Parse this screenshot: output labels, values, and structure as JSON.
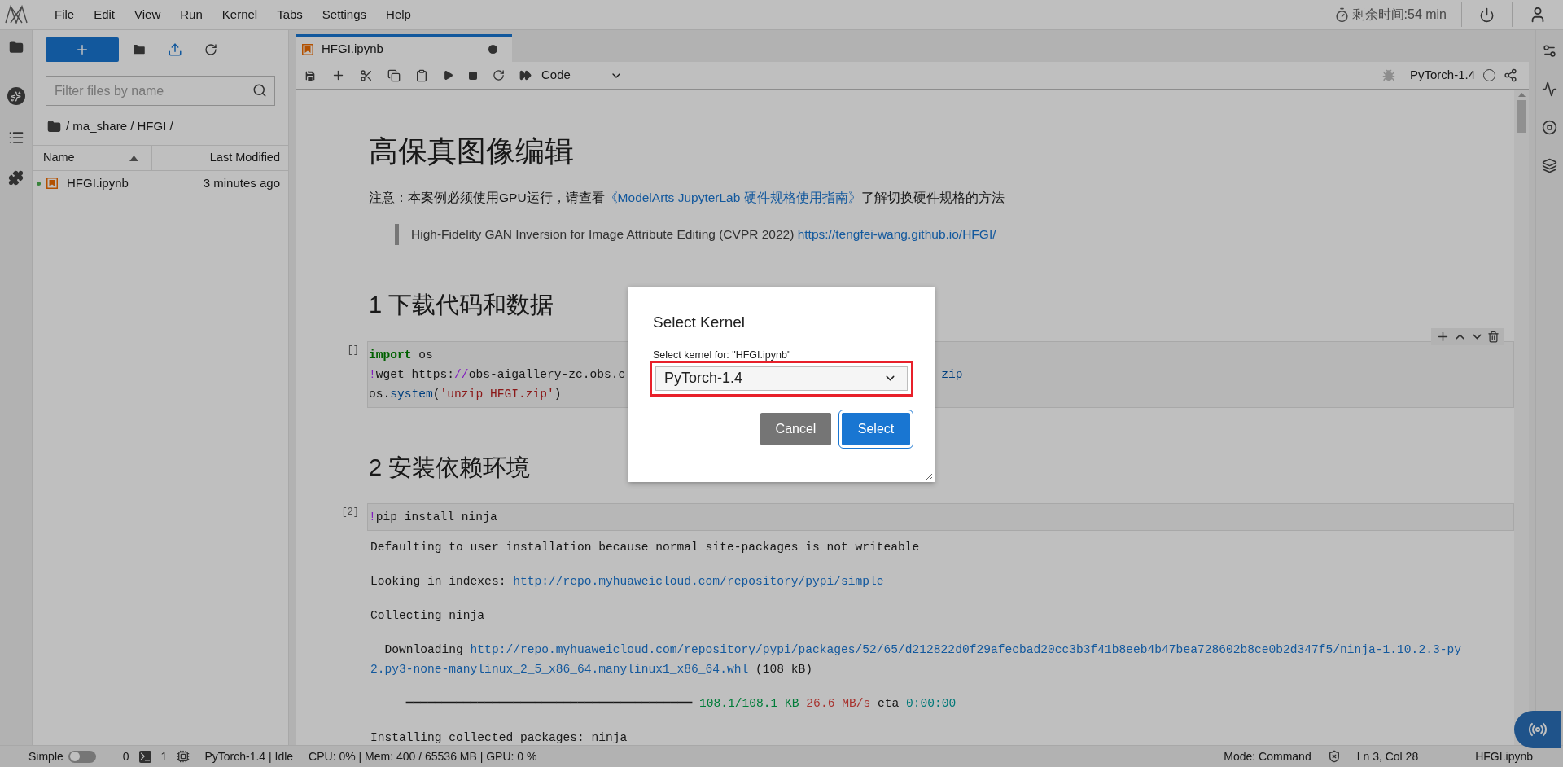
{
  "menu": [
    "File",
    "Edit",
    "View",
    "Run",
    "Kernel",
    "Tabs",
    "Settings",
    "Help"
  ],
  "timer": "剩余时间:54 min",
  "sidebar": {
    "filter_placeholder": "Filter files by name",
    "breadcrumb": "/ ma_share / HFGI /",
    "columns": [
      "Name",
      "Last Modified"
    ],
    "files": [
      {
        "name": "HFGI.ipynb",
        "modified": "3 minutes ago",
        "running": true
      }
    ]
  },
  "tab": {
    "title": "HFGI.ipynb",
    "unsaved": true
  },
  "toolbar": {
    "cell_type": "Code",
    "kernel": "PyTorch-1.4",
    "kernel_busy": false
  },
  "cells": [
    {
      "kind": "heading1",
      "text": "高保真图像编辑"
    },
    {
      "kind": "paragraph",
      "parts": [
        {
          "text": "注意：本案例必须使用GPU运行，请查看",
          "link": false
        },
        {
          "text": "《ModelArts JupyterLab 硬件规格使用指南》",
          "link": true
        },
        {
          "text": "了解切换硬件规格的方法",
          "link": false
        }
      ]
    },
    {
      "kind": "blockquote",
      "parts": [
        {
          "text": "High-Fidelity GAN Inversion for Image Attribute Editing (CVPR 2022) ",
          "link": false
        },
        {
          "text": "https://tengfei-wang.github.io/HFGI/",
          "link": true
        }
      ]
    },
    {
      "kind": "heading2",
      "text": "1 下载代码和数据"
    },
    {
      "kind": "code",
      "prompt": "[]",
      "cell_toolbar": true,
      "lines": [
        [
          {
            "kind": "keyword",
            "text": "import"
          },
          {
            "kind": "plain",
            "text": " os"
          }
        ],
        [
          {
            "kind": "bang",
            "text": "!"
          },
          {
            "kind": "plain",
            "text": "wget https:"
          },
          {
            "kind": "bang",
            "text": "//"
          },
          {
            "kind": "plain",
            "text": "obs-aigallery-zc.obs.c"
          },
          {
            "kind": "tail",
            "text": "zip"
          }
        ],
        [
          {
            "kind": "plain",
            "text": "os."
          },
          {
            "kind": "func",
            "text": "system"
          },
          {
            "kind": "plain",
            "text": "("
          },
          {
            "kind": "string",
            "text": "'unzip HFGI.zip'"
          },
          {
            "kind": "plain",
            "text": ")"
          }
        ]
      ]
    },
    {
      "kind": "heading2",
      "text": "2 安装依赖环境"
    },
    {
      "kind": "code",
      "prompt": "[2]",
      "cell_toolbar": false,
      "lines": [
        [
          {
            "kind": "bang",
            "text": "!"
          },
          {
            "kind": "plain",
            "text": "pip install ninja"
          }
        ]
      ],
      "outputs": [
        [
          {
            "kind": "plain",
            "text": "Defaulting to user installation because normal site-packages is not writeable"
          }
        ],
        [
          {
            "kind": "plain",
            "text": "Looking in indexes: "
          },
          {
            "kind": "link",
            "text": "http://repo.myhuaweicloud.com/repository/pypi/simple"
          }
        ],
        [
          {
            "kind": "plain",
            "text": "Collecting ninja"
          }
        ],
        [
          {
            "kind": "plain",
            "text": "  Downloading "
          },
          {
            "kind": "link",
            "text": "http://repo.myhuaweicloud.com/repository/pypi/packages/52/65/d212822d0f29afecbad20cc3b3f41b8eeb4b47bea728602b8ce0b2d347f5/ninja-1.10.2.3-py"
          }
        ],
        [
          {
            "kind": "link",
            "text": "2.py3-none-manylinux_2_5_x86_64.manylinux1_x86_64.whl"
          },
          {
            "kind": "plain",
            "text": " (108 kB)"
          }
        ],
        [
          {
            "kind": "plain",
            "text": "     ━━━━━━━━━━━━━━━━━━━━━━━━━━━━━━━━━━━━━━━━ "
          },
          {
            "kind": "green",
            "text": "108.1/108.1 KB"
          },
          {
            "kind": "red",
            "text": " 26.6 MB/s"
          },
          {
            "kind": "plain",
            "text": " eta "
          },
          {
            "kind": "teal",
            "text": "0:00:00"
          }
        ],
        [
          {
            "kind": "plain",
            "text": "Installing collected packages: ninja"
          }
        ]
      ]
    }
  ],
  "status": {
    "simple_label": "Simple",
    "simple_on": false,
    "terminals": "0",
    "kernels": "1",
    "kernel_status": "PyTorch-1.4 | Idle",
    "resources": "CPU: 0% | Mem: 400 / 65536 MB | GPU: 0 %",
    "mode": "Mode: Command",
    "position": "Ln 3, Col 28",
    "file": "HFGI.ipynb"
  },
  "dialog": {
    "title": "Select Kernel",
    "label": "Select kernel for: \"HFGI.ipynb\"",
    "value": "PyTorch-1.4",
    "highlighted": true,
    "buttons": [
      {
        "label": "Cancel",
        "kind": "secondary"
      },
      {
        "label": "Select",
        "kind": "primary"
      }
    ]
  }
}
